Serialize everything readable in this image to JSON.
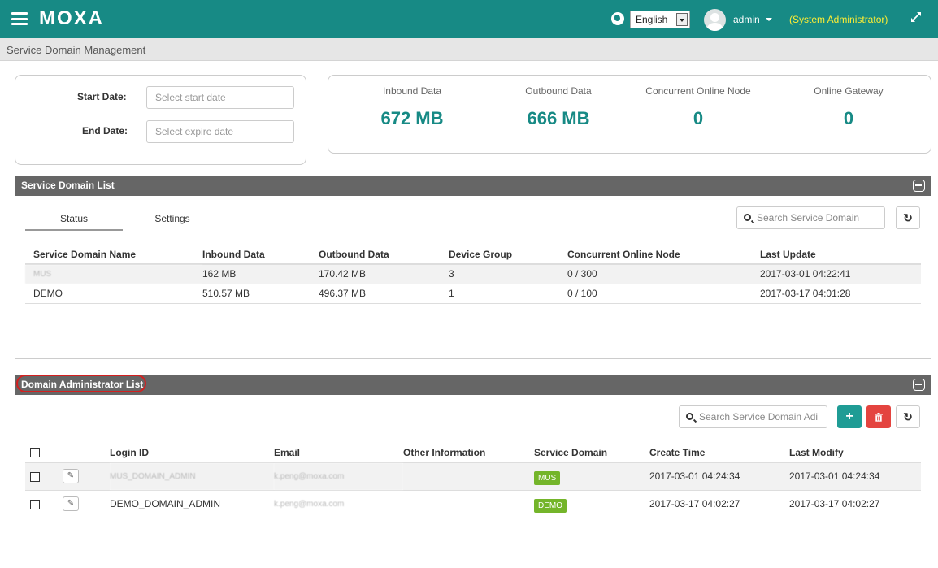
{
  "header": {
    "logo": "MOXA",
    "language": "English",
    "user_name": "admin",
    "user_role": "(System Administrator)"
  },
  "breadcrumb": "Service Domain Management",
  "date_filter": {
    "start_label": "Start Date:",
    "start_placeholder": "Select start date",
    "end_label": "End Date:",
    "end_placeholder": "Select expire date"
  },
  "stats": [
    {
      "label": "Inbound Data",
      "value": "672 MB"
    },
    {
      "label": "Outbound Data",
      "value": "666 MB"
    },
    {
      "label": "Concurrent Online Node",
      "value": "0"
    },
    {
      "label": "Online Gateway",
      "value": "0"
    }
  ],
  "service_domain_list": {
    "title": "Service Domain List",
    "tabs": [
      "Status",
      "Settings"
    ],
    "search_placeholder": "Search Service Domain",
    "columns": [
      "Service Domain Name",
      "Inbound Data",
      "Outbound Data",
      "Device Group",
      "Concurrent Online Node",
      "Last Update"
    ],
    "rows": [
      [
        "MUS",
        "162 MB",
        "170.42 MB",
        "3",
        "0 / 300",
        "2017-03-01 04:22:41"
      ],
      [
        "DEMO",
        "510.57 MB",
        "496.37 MB",
        "1",
        "0 / 100",
        "2017-03-17 04:01:28"
      ]
    ]
  },
  "admin_list": {
    "title": "Domain Administrator List",
    "search_placeholder": "Search Service Domain Adi",
    "columns": [
      "Login ID",
      "Email",
      "Other Information",
      "Service Domain",
      "Create Time",
      "Last Modify"
    ],
    "rows": [
      {
        "login": "MUS_DOMAIN_ADMIN",
        "email": "k.peng@moxa.com",
        "other": "",
        "domain": "MUS",
        "created": "2017-03-01 04:24:34",
        "modified": "2017-03-01 04:24:34"
      },
      {
        "login": "DEMO_DOMAIN_ADMIN",
        "email": "k.peng@moxa.com",
        "other": "",
        "domain": "DEMO",
        "created": "2017-03-17 04:02:27",
        "modified": "2017-03-17 04:02:27"
      }
    ]
  },
  "colors": {
    "header": "#178a85",
    "accent": "#178a85",
    "role": "#ffee33",
    "badge": "#74b52a",
    "delete": "#e4443f",
    "highlight": "#d42020"
  }
}
